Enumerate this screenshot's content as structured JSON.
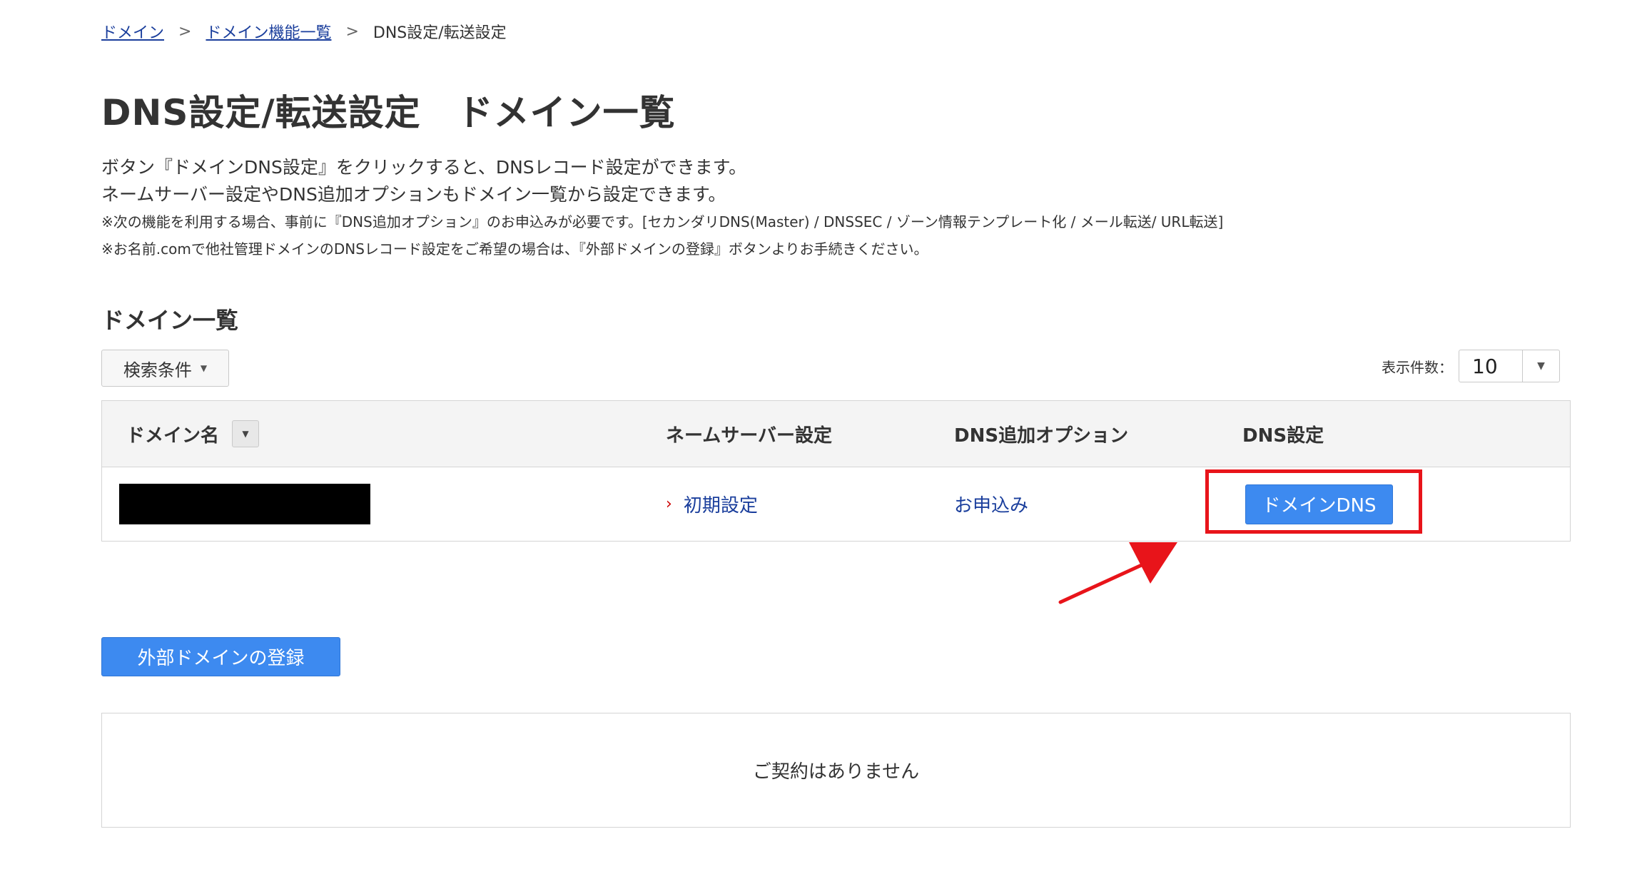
{
  "breadcrumb": {
    "items": [
      "ドメイン",
      "ドメイン機能一覧"
    ],
    "separator": ">",
    "current": "DNS設定/転送設定"
  },
  "page_title": "DNS設定/転送設定　ドメイン一覧",
  "intro": {
    "line1": "ボタン『ドメインDNS設定』をクリックすると、DNSレコード設定ができます。",
    "line2": "ネームサーバー設定やDNS追加オプションもドメイン一覧から設定できます。",
    "note1": "※次の機能を利用する場合、事前に『DNS追加オプション』のお申込みが必要です。[セカンダリDNS(Master) / DNSSEC / ゾーン情報テンプレート化 / メール転送/ URL転送]",
    "note2": "※お名前.comで他社管理ドメインのDNSレコード設定をご希望の場合は、『外部ドメインの登録』ボタンよりお手続きください。"
  },
  "section_title": "ドメイン一覧",
  "search_button": "検索条件",
  "per_page": {
    "label": "表示件数：",
    "value": "10"
  },
  "table": {
    "headers": [
      "ドメイン名",
      "ネームサーバー設定",
      "DNS追加オプション",
      "DNS設定"
    ],
    "rows": [
      {
        "nameserver": "初期設定",
        "option": "お申込み",
        "dns_button": "ドメインDNS"
      }
    ]
  },
  "external_button": "外部ドメインの登録",
  "empty_message": "ご契約はありません",
  "colors": {
    "link": "#1a3e9c",
    "primary_button": "#3d8af0",
    "annotation": "#e8141a"
  },
  "icons": {
    "breadcrumb_separator": "chevron-right-icon",
    "search_caret": "caret-down-icon",
    "sort": "caret-down-icon",
    "nameserver_link": "chevron-right-icon"
  }
}
